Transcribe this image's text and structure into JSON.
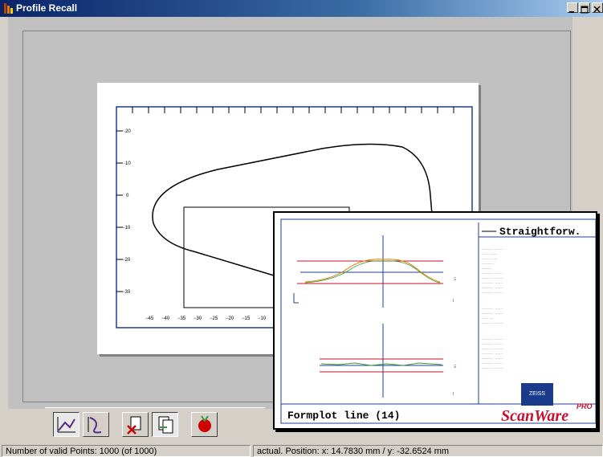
{
  "window": {
    "title": "Profile Recall",
    "buttons": [
      "minimize",
      "maximize",
      "close"
    ]
  },
  "toolbar": {
    "buttons": [
      {
        "name": "profile-view-button",
        "icon": "profile-chart-icon",
        "pressed": true
      },
      {
        "name": "profile-zoom-button",
        "icon": "profile-zoom-icon",
        "pressed": false
      },
      {
        "name": "delete-profile-button",
        "icon": "delete-profile-icon",
        "pressed": false
      },
      {
        "name": "copy-profile-button",
        "icon": "copy-profile-icon",
        "pressed": true
      },
      {
        "name": "record-button",
        "icon": "record-icon",
        "pressed": false
      }
    ]
  },
  "status": {
    "valid_points": "Number of valid Points: 1000 (of 1000)",
    "position": "actual. Position: x:  14.7830 mm / y:  -32.6524 mm"
  },
  "overlay": {
    "legend_title": "Straightforw.",
    "footer_title": "Formplot line (14)",
    "brand": "ScanWare",
    "brand_suffix": "PRO",
    "logo": "ZEISS"
  }
}
